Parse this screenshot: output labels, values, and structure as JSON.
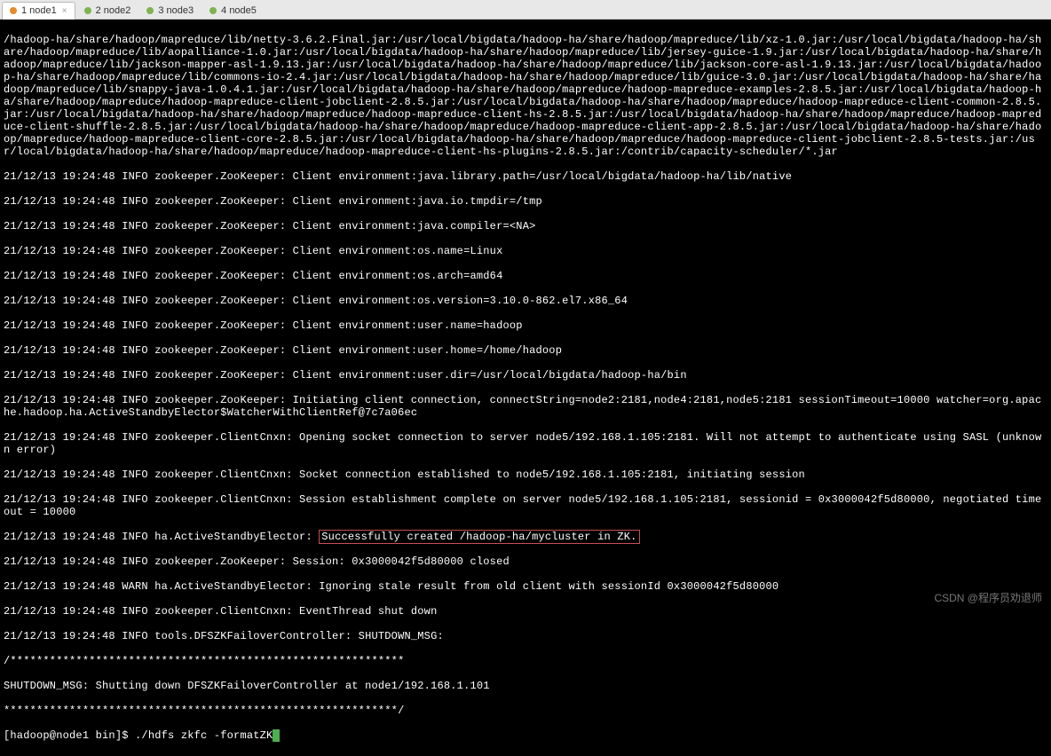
{
  "tabs": [
    {
      "label": "1 node1",
      "active": true
    },
    {
      "label": "2 node2",
      "active": false
    },
    {
      "label": "3 node3",
      "active": false
    },
    {
      "label": "4 node5",
      "active": false
    }
  ],
  "terminal": {
    "block1": "/hadoop-ha/share/hadoop/mapreduce/lib/netty-3.6.2.Final.jar:/usr/local/bigdata/hadoop-ha/share/hadoop/mapreduce/lib/xz-1.0.jar:/usr/local/bigdata/hadoop-ha/share/hadoop/mapreduce/lib/aopalliance-1.0.jar:/usr/local/bigdata/hadoop-ha/share/hadoop/mapreduce/lib/jersey-guice-1.9.jar:/usr/local/bigdata/hadoop-ha/share/hadoop/mapreduce/lib/jackson-mapper-asl-1.9.13.jar:/usr/local/bigdata/hadoop-ha/share/hadoop/mapreduce/lib/jackson-core-asl-1.9.13.jar:/usr/local/bigdata/hadoop-ha/share/hadoop/mapreduce/lib/commons-io-2.4.jar:/usr/local/bigdata/hadoop-ha/share/hadoop/mapreduce/lib/guice-3.0.jar:/usr/local/bigdata/hadoop-ha/share/hadoop/mapreduce/lib/snappy-java-1.0.4.1.jar:/usr/local/bigdata/hadoop-ha/share/hadoop/mapreduce/hadoop-mapreduce-examples-2.8.5.jar:/usr/local/bigdata/hadoop-ha/share/hadoop/mapreduce/hadoop-mapreduce-client-jobclient-2.8.5.jar:/usr/local/bigdata/hadoop-ha/share/hadoop/mapreduce/hadoop-mapreduce-client-common-2.8.5.jar:/usr/local/bigdata/hadoop-ha/share/hadoop/mapreduce/hadoop-mapreduce-client-hs-2.8.5.jar:/usr/local/bigdata/hadoop-ha/share/hadoop/mapreduce/hadoop-mapreduce-client-shuffle-2.8.5.jar:/usr/local/bigdata/hadoop-ha/share/hadoop/mapreduce/hadoop-mapreduce-client-app-2.8.5.jar:/usr/local/bigdata/hadoop-ha/share/hadoop/mapreduce/hadoop-mapreduce-client-core-2.8.5.jar:/usr/local/bigdata/hadoop-ha/share/hadoop/mapreduce/hadoop-mapreduce-client-jobclient-2.8.5-tests.jar:/usr/local/bigdata/hadoop-ha/share/hadoop/mapreduce/hadoop-mapreduce-client-hs-plugins-2.8.5.jar:/contrib/capacity-scheduler/*.jar",
    "l1": "21/12/13 19:24:48 INFO zookeeper.ZooKeeper: Client environment:java.library.path=/usr/local/bigdata/hadoop-ha/lib/native",
    "l2": "21/12/13 19:24:48 INFO zookeeper.ZooKeeper: Client environment:java.io.tmpdir=/tmp",
    "l3": "21/12/13 19:24:48 INFO zookeeper.ZooKeeper: Client environment:java.compiler=<NA>",
    "l4": "21/12/13 19:24:48 INFO zookeeper.ZooKeeper: Client environment:os.name=Linux",
    "l5": "21/12/13 19:24:48 INFO zookeeper.ZooKeeper: Client environment:os.arch=amd64",
    "l6": "21/12/13 19:24:48 INFO zookeeper.ZooKeeper: Client environment:os.version=3.10.0-862.el7.x86_64",
    "l7": "21/12/13 19:24:48 INFO zookeeper.ZooKeeper: Client environment:user.name=hadoop",
    "l8": "21/12/13 19:24:48 INFO zookeeper.ZooKeeper: Client environment:user.home=/home/hadoop",
    "l9": "21/12/13 19:24:48 INFO zookeeper.ZooKeeper: Client environment:user.dir=/usr/local/bigdata/hadoop-ha/bin",
    "l10": "21/12/13 19:24:48 INFO zookeeper.ZooKeeper: Initiating client connection, connectString=node2:2181,node4:2181,node5:2181 sessionTimeout=10000 watcher=org.apache.hadoop.ha.ActiveStandbyElector$WatcherWithClientRef@7c7a06ec",
    "l11": "21/12/13 19:24:48 INFO zookeeper.ClientCnxn: Opening socket connection to server node5/192.168.1.105:2181. Will not attempt to authenticate using SASL (unknown error)",
    "l12": "21/12/13 19:24:48 INFO zookeeper.ClientCnxn: Socket connection established to node5/192.168.1.105:2181, initiating session",
    "l13": "21/12/13 19:24:48 INFO zookeeper.ClientCnxn: Session establishment complete on server node5/192.168.1.105:2181, sessionid = 0x3000042f5d80000, negotiated timeout = 10000",
    "l14_pre": "21/12/13 19:24:48 INFO ha.ActiveStandbyElector: ",
    "l14_hl": "Successfully created /hadoop-ha/mycluster in ZK.",
    "l15": "21/12/13 19:24:48 INFO zookeeper.ZooKeeper: Session: 0x3000042f5d80000 closed",
    "l16": "21/12/13 19:24:48 WARN ha.ActiveStandbyElector: Ignoring stale result from old client with sessionId 0x3000042f5d80000",
    "l17": "21/12/13 19:24:48 INFO zookeeper.ClientCnxn: EventThread shut down",
    "l18": "21/12/13 19:24:48 INFO tools.DFSZKFailoverController: SHUTDOWN_MSG:",
    "l19": "/************************************************************",
    "l20": "SHUTDOWN_MSG: Shutting down DFSZKFailoverController at node1/192.168.1.101",
    "l21": "************************************************************/",
    "prompt": "[hadoop@node1 bin]$ ",
    "cmd": "./hdfs zkfc -formatZK"
  },
  "watermark": "CSDN @程序员劝退师"
}
